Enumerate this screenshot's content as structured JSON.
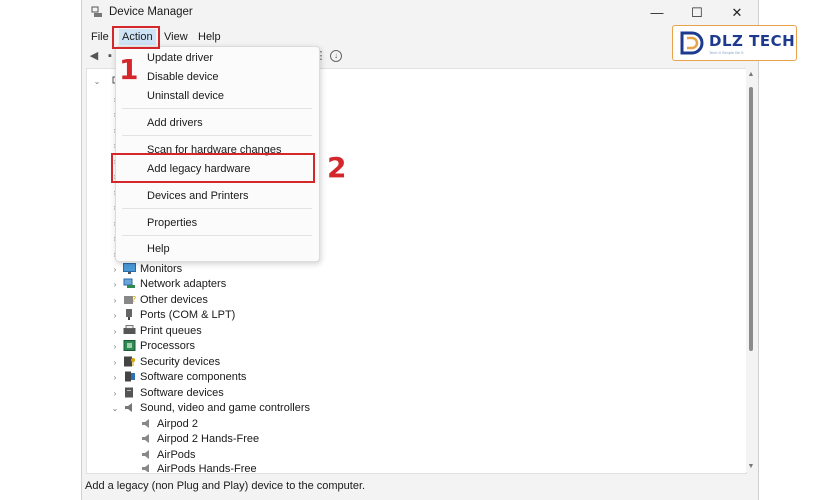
{
  "window": {
    "title": "Device Manager",
    "controls": {
      "minimize": "—",
      "maximize": "☐",
      "close": "✕"
    }
  },
  "menubar": {
    "items": [
      "File",
      "Action",
      "View",
      "Help"
    ],
    "active": "Action"
  },
  "action_menu": {
    "items": [
      "Update driver",
      "Disable device",
      "Uninstall device",
      "Add drivers",
      "Scan for hardware changes",
      "Add legacy hardware",
      "Devices and Printers",
      "Properties",
      "Help"
    ],
    "highlighted": "Add legacy hardware"
  },
  "annotations": {
    "step1": "1",
    "step2": "2",
    "color": "#d3272b"
  },
  "tree": {
    "categories": [
      {
        "label": "Monitors",
        "icon": "monitor-icon",
        "expanded": false
      },
      {
        "label": "Network adapters",
        "icon": "network-adapter-icon",
        "expanded": false
      },
      {
        "label": "Other devices",
        "icon": "other-devices-icon",
        "expanded": false
      },
      {
        "label": "Ports (COM & LPT)",
        "icon": "port-icon",
        "expanded": false
      },
      {
        "label": "Print queues",
        "icon": "printer-icon",
        "expanded": false
      },
      {
        "label": "Processors",
        "icon": "processor-icon",
        "expanded": false
      },
      {
        "label": "Security devices",
        "icon": "security-device-icon",
        "expanded": false
      },
      {
        "label": "Software components",
        "icon": "software-component-icon",
        "expanded": false
      },
      {
        "label": "Software devices",
        "icon": "software-device-icon",
        "expanded": false
      },
      {
        "label": "Sound, video and game controllers",
        "icon": "speaker-icon",
        "expanded": true
      }
    ],
    "sound_children": [
      "Airpod 2",
      "Airpod 2 Hands-Free",
      "AirPods",
      "AirPods Hands-Free"
    ]
  },
  "statusbar": {
    "text": "Add a legacy (non Plug and Play) device to the computer."
  },
  "logo": {
    "brand": "DLZ TECH",
    "tagline": "Tech It Simple Be It",
    "accent": "#e8a24a",
    "brand_color": "#1d3a8f"
  }
}
